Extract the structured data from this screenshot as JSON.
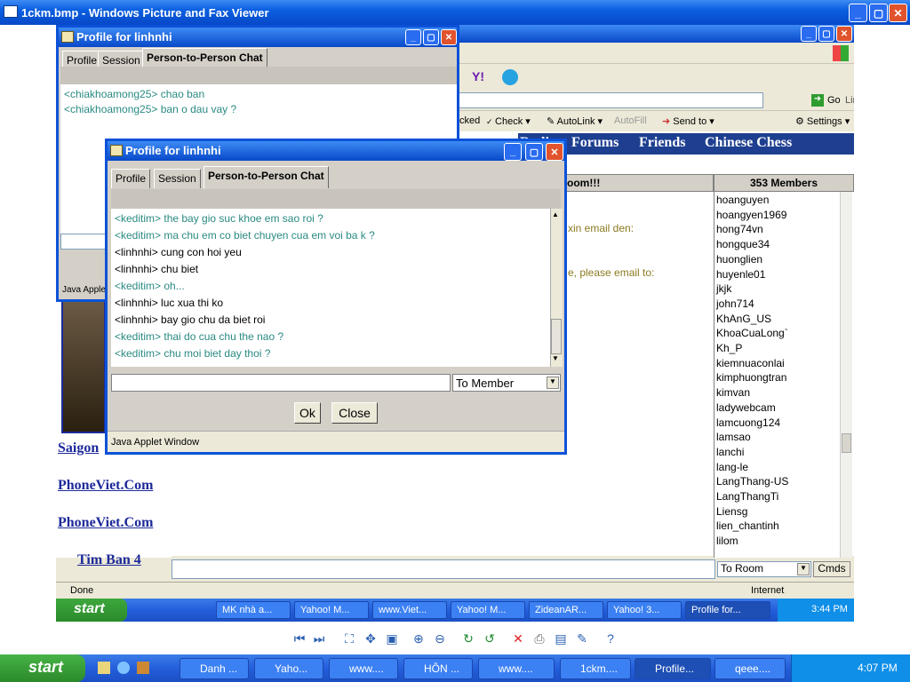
{
  "viewer": {
    "title": "1ckm.bmp - Windows Picture and Fax Viewer"
  },
  "ie": {
    "go_label": "Go",
    "links_label": "Links",
    "tools": {
      "blocked": "cked",
      "check": "Check",
      "autolink": "AutoLink",
      "autofill": "AutoFill",
      "sendto": "Send to",
      "settings": "Settings"
    },
    "nav": [
      "Radio",
      "Forums",
      "Friends",
      "Chinese Chess"
    ],
    "room_header": "oom!!!",
    "room_messages": [
      "xin email den:",
      "e, please email to:"
    ],
    "members_header": "353 Members",
    "members": [
      "hoanguyen",
      "hoangyen1969",
      "hong74vn",
      "hongque34",
      "huonglien",
      "huyenle01",
      "jkjk",
      "john714",
      "KhAnG_US",
      "KhoaCuaLong`",
      "Kh_P",
      "kiemnuaconlai",
      "kimphuongtran",
      "kimvan",
      "ladywebcam",
      "lamcuong124",
      "lamsao",
      "lanchi",
      "lang-le",
      "LangThang-US",
      "LangThangTi",
      "Liensg",
      "lien_chantinh",
      "lilom"
    ],
    "to_room": "To Room",
    "cmds": "Cmds",
    "left_links": [
      "Saigon",
      "PhoneViet.Com",
      "PhoneViet.Com",
      "Tim Ban 4"
    ],
    "status_done": "Done",
    "status_zone": "Internet"
  },
  "inner_taskbar": {
    "start": "start",
    "items": [
      "MK nhà a...",
      "Yahoo! M...",
      "www.Viet...",
      "Yahoo! M...",
      "ZideanAR...",
      "Yahoo! 3...",
      "Profile for..."
    ],
    "clock": "3:44 PM"
  },
  "applet_back": {
    "title": "Profile for linhnhi",
    "tabs": [
      "Profile",
      "Session",
      "Person-to-Person Chat"
    ],
    "lines": [
      "<chiakhoamong25> chao ban",
      "<chiakhoamong25> ban o dau vay ?"
    ],
    "footer": "Java Applet"
  },
  "applet_front": {
    "title": "Profile for linhnhi",
    "tabs": [
      "Profile",
      "Session",
      "Person-to-Person Chat"
    ],
    "lines": [
      {
        "text": "<keditim> the bay gio suc khoe em sao roi ?",
        "who": "them"
      },
      {
        "text": "<keditim> ma chu em co biet chuyen cua em voi ba k ?",
        "who": "them"
      },
      {
        "text": "<linhnhi>  cung con hoi yeu",
        "who": "me"
      },
      {
        "text": "<linhnhi>  chu biet",
        "who": "me"
      },
      {
        "text": "<keditim> oh...",
        "who": "them"
      },
      {
        "text": "<linhnhi>  luc xua thi ko",
        "who": "me"
      },
      {
        "text": "<linhnhi>  bay gio chu da biet roi",
        "who": "me"
      },
      {
        "text": "<keditim> thai do cua chu the nao ?",
        "who": "them"
      },
      {
        "text": "<keditim> chu moi biet day thoi ?",
        "who": "them"
      }
    ],
    "to_member": "To Member",
    "ok": "Ok",
    "close": "Close",
    "footer": "Java Applet Window"
  },
  "taskbar": {
    "start": "start",
    "items": [
      "Danh ...",
      "Yaho...",
      "www....",
      "HÔN ...",
      "www....",
      "1ckm....",
      "Profile...",
      "qeee...."
    ],
    "clock": "4:07 PM"
  }
}
